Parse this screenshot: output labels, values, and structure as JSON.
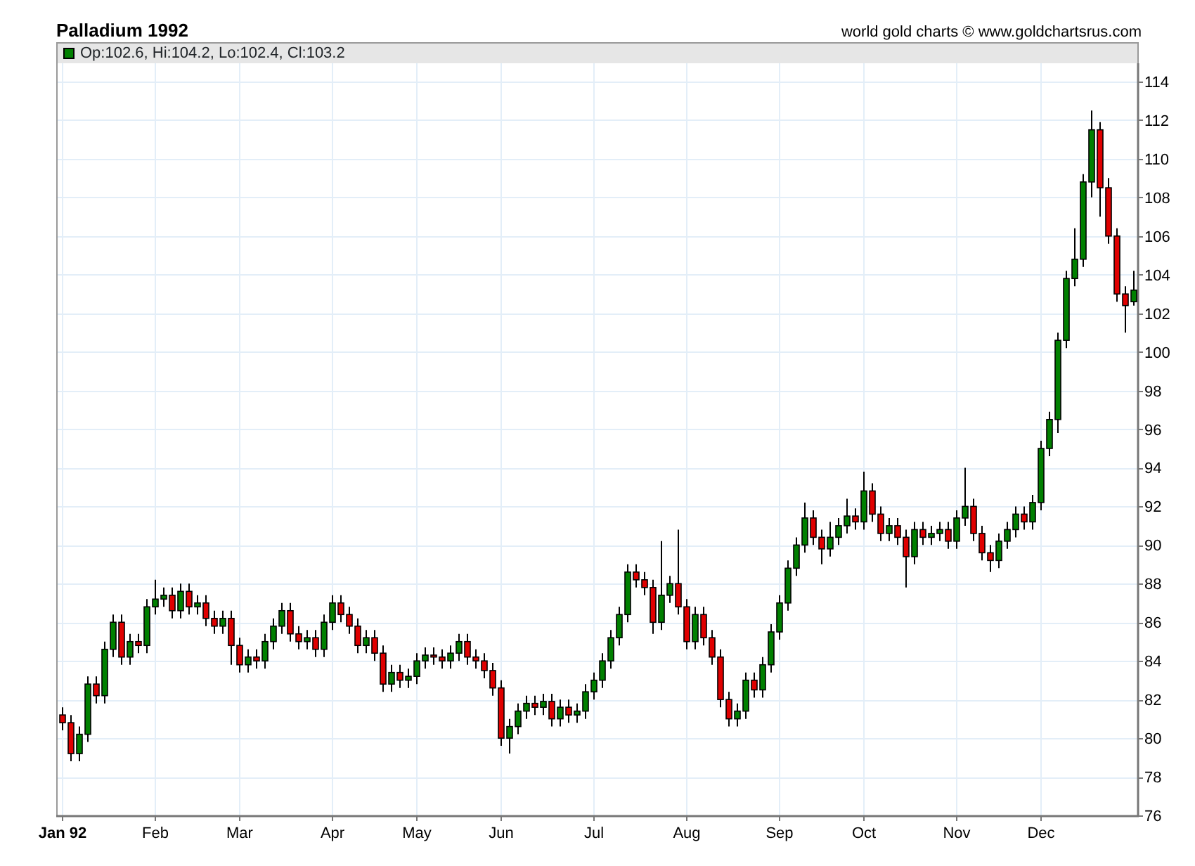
{
  "header": {
    "title": "Palladium 1992",
    "credit": "world gold charts © www.goldchartsrus.com"
  },
  "legend": {
    "text": "Op:102.6, Hi:104.2, Lo:102.4, Cl:103.2",
    "color": "#008000"
  },
  "chart": {
    "chart_data": {
      "type": "candlestick",
      "grid": true,
      "ylim": [
        76,
        114
      ],
      "yticks": [
        76,
        78,
        80,
        82,
        84,
        86,
        88,
        90,
        92,
        94,
        96,
        98,
        100,
        102,
        104,
        106,
        108,
        110,
        112,
        114
      ],
      "categories": [
        "Jan 92",
        null,
        null,
        null,
        null,
        null,
        null,
        null,
        null,
        null,
        null,
        "Feb",
        null,
        null,
        null,
        null,
        null,
        null,
        null,
        null,
        null,
        "Mar",
        null,
        null,
        null,
        null,
        null,
        null,
        null,
        null,
        null,
        null,
        "Apr",
        null,
        null,
        null,
        null,
        null,
        null,
        null,
        null,
        null,
        "May",
        null,
        null,
        null,
        null,
        null,
        null,
        null,
        null,
        null,
        "Jun",
        null,
        null,
        null,
        null,
        null,
        null,
        null,
        null,
        null,
        null,
        "Jul",
        null,
        null,
        null,
        null,
        null,
        null,
        null,
        null,
        null,
        null,
        "Aug",
        null,
        null,
        null,
        null,
        null,
        null,
        null,
        null,
        null,
        null,
        "Sep",
        null,
        null,
        null,
        null,
        null,
        null,
        null,
        null,
        null,
        "Oct",
        null,
        null,
        null,
        null,
        null,
        null,
        null,
        null,
        null,
        null,
        "Nov",
        null,
        null,
        null,
        null,
        null,
        null,
        null,
        null,
        null,
        "Dec",
        null,
        null,
        null,
        null,
        null,
        null,
        null,
        null,
        null,
        null,
        null
      ],
      "ohlc": [
        [
          81.2,
          81.6,
          80.4,
          80.8
        ],
        [
          80.8,
          81.2,
          78.8,
          79.2
        ],
        [
          79.2,
          80.6,
          78.8,
          80.2
        ],
        [
          80.2,
          83.2,
          79.8,
          82.8
        ],
        [
          82.8,
          83.2,
          81.8,
          82.2
        ],
        [
          82.2,
          85.0,
          81.8,
          84.6
        ],
        [
          84.6,
          86.4,
          84.2,
          86.0
        ],
        [
          86.0,
          86.4,
          83.8,
          84.2
        ],
        [
          84.2,
          85.4,
          83.8,
          85.0
        ],
        [
          85.0,
          85.4,
          84.4,
          84.8
        ],
        [
          84.8,
          87.2,
          84.4,
          86.8
        ],
        [
          86.8,
          88.2,
          86.4,
          87.2
        ],
        [
          87.2,
          87.8,
          86.8,
          87.4
        ],
        [
          87.4,
          87.8,
          86.2,
          86.6
        ],
        [
          86.6,
          88.0,
          86.2,
          87.6
        ],
        [
          87.6,
          88.0,
          86.4,
          86.8
        ],
        [
          86.8,
          87.4,
          86.4,
          87.0
        ],
        [
          87.0,
          87.4,
          85.8,
          86.2
        ],
        [
          86.2,
          86.6,
          85.4,
          85.8
        ],
        [
          85.8,
          86.6,
          85.4,
          86.2
        ],
        [
          86.2,
          86.6,
          83.8,
          84.8
        ],
        [
          84.8,
          85.2,
          83.4,
          83.8
        ],
        [
          83.8,
          84.6,
          83.4,
          84.2
        ],
        [
          84.2,
          84.6,
          83.6,
          84.0
        ],
        [
          84.0,
          85.4,
          83.6,
          85.0
        ],
        [
          85.0,
          86.2,
          84.6,
          85.8
        ],
        [
          85.8,
          87.0,
          85.4,
          86.6
        ],
        [
          86.6,
          87.0,
          85.0,
          85.4
        ],
        [
          85.4,
          85.8,
          84.6,
          85.0
        ],
        [
          85.0,
          85.6,
          84.6,
          85.2
        ],
        [
          85.2,
          85.6,
          84.2,
          84.6
        ],
        [
          84.6,
          86.4,
          84.2,
          86.0
        ],
        [
          86.0,
          87.4,
          85.6,
          87.0
        ],
        [
          87.0,
          87.4,
          86.0,
          86.4
        ],
        [
          86.4,
          86.8,
          85.4,
          85.8
        ],
        [
          85.8,
          86.2,
          84.4,
          84.8
        ],
        [
          84.8,
          85.6,
          84.4,
          85.2
        ],
        [
          85.2,
          85.6,
          84.0,
          84.4
        ],
        [
          84.4,
          84.8,
          82.4,
          82.8
        ],
        [
          82.8,
          83.8,
          82.4,
          83.4
        ],
        [
          83.4,
          83.8,
          82.6,
          83.0
        ],
        [
          83.0,
          83.6,
          82.6,
          83.2
        ],
        [
          83.2,
          84.4,
          82.8,
          84.0
        ],
        [
          84.0,
          84.7,
          83.6,
          84.3
        ],
        [
          84.3,
          84.7,
          83.8,
          84.2
        ],
        [
          84.2,
          84.6,
          83.6,
          84.0
        ],
        [
          84.0,
          84.8,
          83.6,
          84.4
        ],
        [
          84.4,
          85.4,
          84.0,
          85.0
        ],
        [
          85.0,
          85.4,
          83.8,
          84.2
        ],
        [
          84.2,
          84.6,
          83.6,
          84.0
        ],
        [
          84.0,
          84.4,
          83.1,
          83.5
        ],
        [
          83.5,
          83.9,
          82.2,
          82.6
        ],
        [
          82.6,
          83.0,
          79.6,
          80.0
        ],
        [
          80.0,
          81.0,
          79.2,
          80.6
        ],
        [
          80.6,
          81.8,
          80.2,
          81.4
        ],
        [
          81.4,
          82.2,
          81.0,
          81.8
        ],
        [
          81.8,
          82.2,
          81.2,
          81.6
        ],
        [
          81.6,
          82.3,
          81.2,
          81.9
        ],
        [
          81.9,
          82.3,
          80.6,
          81.0
        ],
        [
          81.0,
          82.0,
          80.6,
          81.6
        ],
        [
          81.6,
          82.0,
          80.8,
          81.2
        ],
        [
          81.2,
          81.8,
          80.8,
          81.4
        ],
        [
          81.4,
          82.8,
          81.0,
          82.4
        ],
        [
          82.4,
          83.4,
          82.0,
          83.0
        ],
        [
          83.0,
          84.4,
          82.6,
          84.0
        ],
        [
          84.0,
          85.6,
          83.6,
          85.2
        ],
        [
          85.2,
          86.8,
          84.8,
          86.4
        ],
        [
          86.4,
          89.0,
          86.0,
          88.6
        ],
        [
          88.6,
          89.0,
          87.8,
          88.2
        ],
        [
          88.2,
          88.6,
          87.4,
          87.8
        ],
        [
          87.8,
          88.2,
          85.4,
          86.0
        ],
        [
          86.0,
          90.2,
          85.6,
          87.4
        ],
        [
          87.4,
          88.4,
          87.0,
          88.0
        ],
        [
          88.0,
          90.8,
          86.4,
          86.8
        ],
        [
          86.8,
          87.2,
          84.6,
          85.0
        ],
        [
          85.0,
          86.8,
          84.6,
          86.4
        ],
        [
          86.4,
          86.8,
          84.8,
          85.2
        ],
        [
          85.2,
          85.6,
          83.8,
          84.2
        ],
        [
          84.2,
          84.6,
          81.6,
          82.0
        ],
        [
          82.0,
          82.4,
          80.6,
          81.0
        ],
        [
          81.0,
          81.8,
          80.6,
          81.4
        ],
        [
          81.4,
          83.4,
          81.0,
          83.0
        ],
        [
          83.0,
          83.4,
          82.1,
          82.5
        ],
        [
          82.5,
          84.2,
          82.1,
          83.8
        ],
        [
          83.8,
          85.9,
          83.4,
          85.5
        ],
        [
          85.5,
          87.4,
          85.1,
          87.0
        ],
        [
          87.0,
          89.2,
          86.6,
          88.8
        ],
        [
          88.8,
          90.4,
          88.4,
          90.0
        ],
        [
          90.0,
          92.2,
          89.6,
          91.4
        ],
        [
          91.4,
          91.8,
          90.0,
          90.4
        ],
        [
          90.4,
          90.8,
          89.0,
          89.8
        ],
        [
          89.8,
          91.2,
          89.4,
          90.4
        ],
        [
          90.4,
          91.4,
          90.0,
          91.0
        ],
        [
          91.0,
          92.4,
          90.6,
          91.5
        ],
        [
          91.5,
          91.9,
          90.8,
          91.2
        ],
        [
          91.2,
          93.8,
          90.8,
          92.8
        ],
        [
          92.8,
          93.2,
          91.2,
          91.6
        ],
        [
          91.6,
          92.0,
          90.2,
          90.6
        ],
        [
          90.6,
          91.4,
          90.2,
          91.0
        ],
        [
          91.0,
          91.4,
          90.0,
          90.4
        ],
        [
          90.4,
          90.8,
          87.8,
          89.4
        ],
        [
          89.4,
          91.2,
          89.0,
          90.8
        ],
        [
          90.8,
          91.2,
          90.0,
          90.4
        ],
        [
          90.4,
          91.0,
          90.0,
          90.6
        ],
        [
          90.6,
          91.2,
          90.2,
          90.8
        ],
        [
          90.8,
          91.2,
          89.8,
          90.2
        ],
        [
          90.2,
          91.8,
          89.8,
          91.4
        ],
        [
          91.4,
          94.0,
          91.0,
          92.0
        ],
        [
          92.0,
          92.4,
          90.2,
          90.6
        ],
        [
          90.6,
          91.0,
          89.2,
          89.6
        ],
        [
          89.6,
          90.0,
          88.6,
          89.2
        ],
        [
          89.2,
          90.6,
          88.8,
          90.2
        ],
        [
          90.2,
          91.2,
          89.8,
          90.8
        ],
        [
          90.8,
          92.0,
          90.4,
          91.6
        ],
        [
          91.6,
          92.0,
          90.8,
          91.2
        ],
        [
          91.2,
          92.6,
          90.8,
          92.2
        ],
        [
          92.2,
          95.4,
          91.8,
          95.0
        ],
        [
          95.0,
          96.9,
          94.6,
          96.5
        ],
        [
          96.5,
          101.0,
          95.8,
          100.6
        ],
        [
          100.6,
          104.2,
          100.2,
          103.8
        ],
        [
          103.8,
          106.4,
          103.4,
          104.8
        ],
        [
          104.8,
          109.2,
          104.4,
          108.8
        ],
        [
          108.8,
          112.5,
          108.0,
          111.5
        ],
        [
          111.5,
          111.9,
          107.0,
          108.5
        ],
        [
          108.5,
          109.0,
          105.6,
          106.0
        ],
        [
          106.0,
          106.4,
          102.6,
          103.0
        ],
        [
          103.0,
          103.4,
          101.0,
          102.4
        ],
        [
          102.6,
          104.2,
          102.4,
          103.2
        ]
      ]
    }
  }
}
